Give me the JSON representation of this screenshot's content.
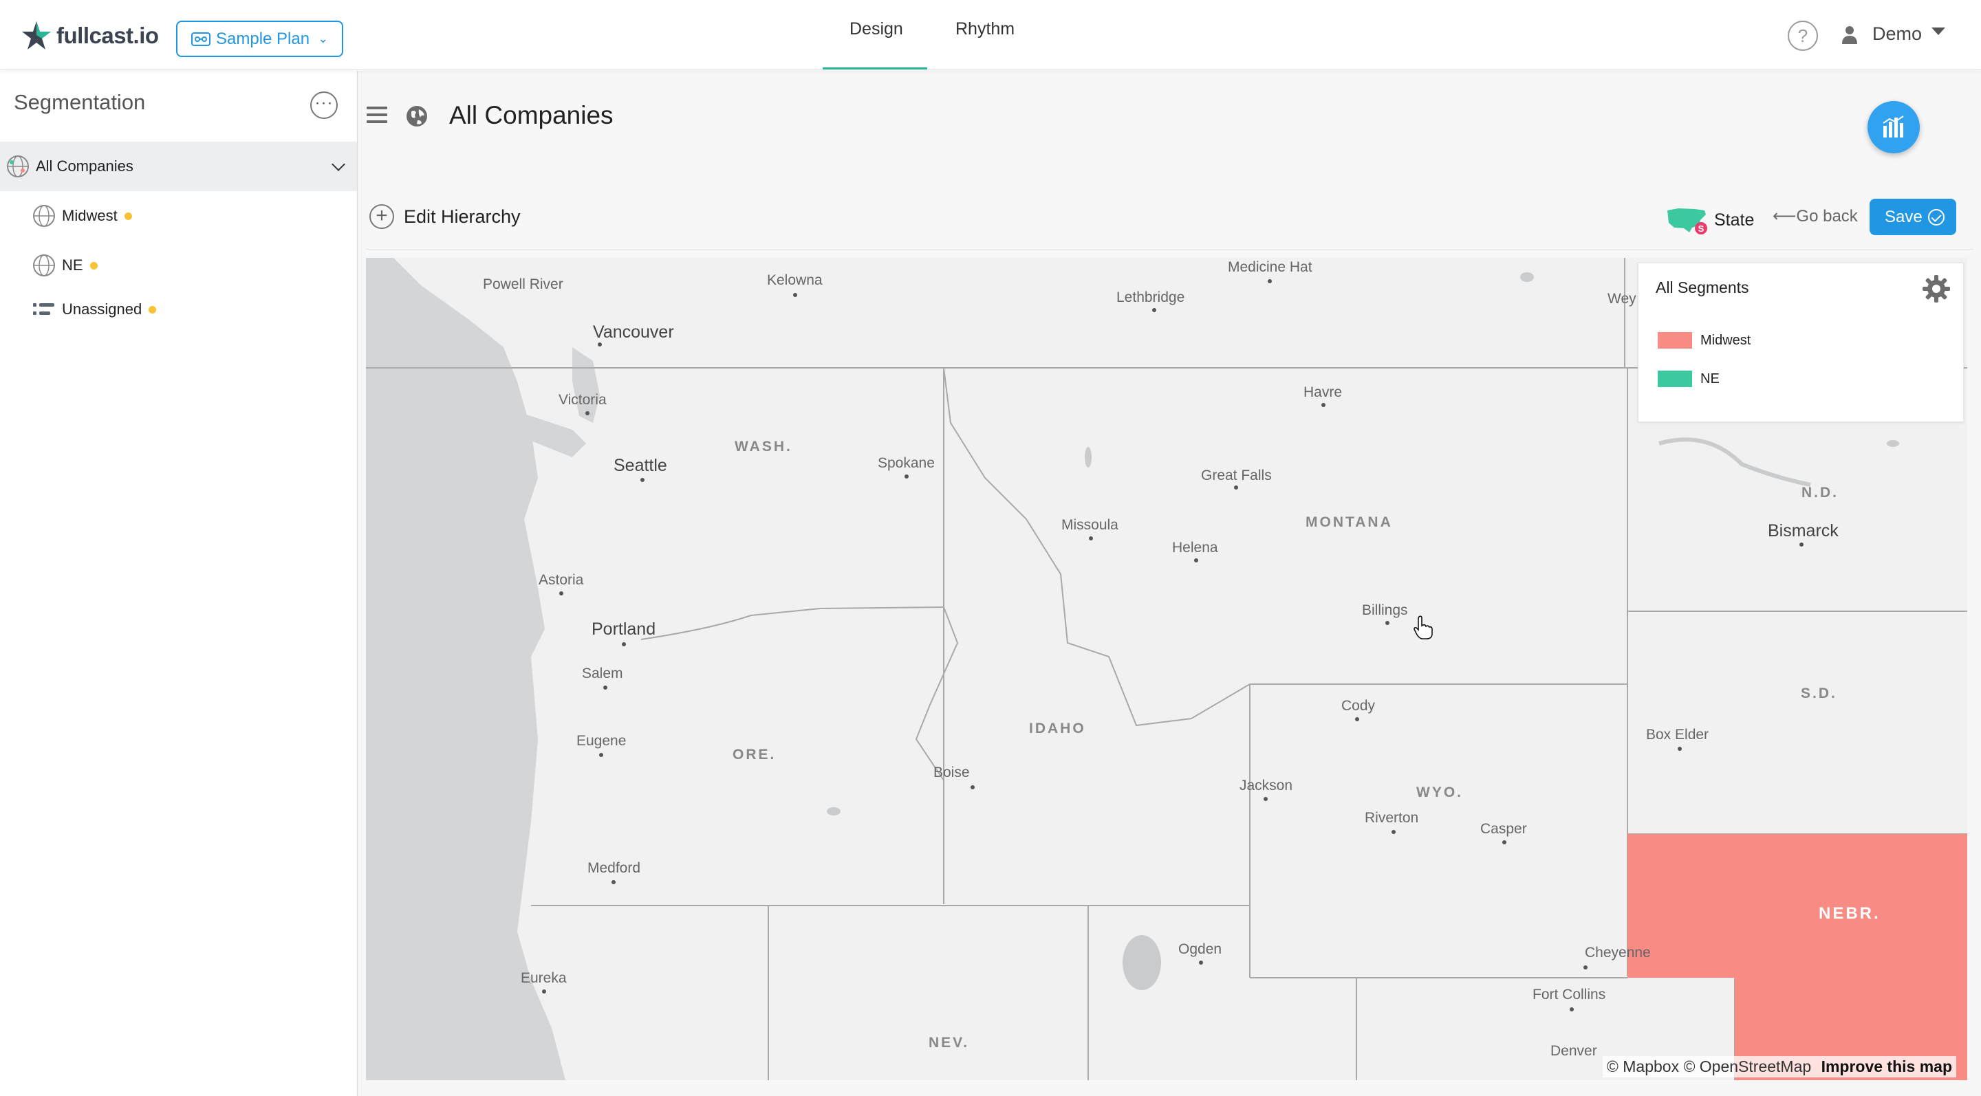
{
  "header": {
    "logo_text": "fullcast.io",
    "plan_button_label": "Sample Plan",
    "tabs": [
      {
        "label": "Design",
        "active": true
      },
      {
        "label": "Rhythm",
        "active": false
      }
    ],
    "help_label": "?",
    "user_name": "Demo"
  },
  "sidebar": {
    "title": "Segmentation",
    "more_label": "···",
    "items": [
      {
        "label": "All Companies",
        "active": true,
        "icon": "globe-icon"
      },
      {
        "label": "Midwest",
        "status_color": "#f7c233",
        "icon": "globe-icon"
      },
      {
        "label": "NE",
        "status_color": "#f7c233",
        "icon": "globe-icon"
      },
      {
        "label": "Unassigned",
        "status_color": "#f7c233",
        "icon": "list-icon"
      }
    ]
  },
  "main": {
    "title": "All Companies",
    "edit_hierarchy_label": "Edit Hierarchy",
    "level_toggle_label": "State",
    "go_back_label": "⟵Go back",
    "save_label": "Save"
  },
  "legend": {
    "title": "All Segments",
    "items": [
      {
        "label": "Midwest",
        "color": "#f98b85"
      },
      {
        "label": "NE",
        "color": "#3cc9a0"
      }
    ]
  },
  "map": {
    "cities": [
      "Medicine Hat",
      "Powell River",
      "Kelowna",
      "Lethbridge",
      "Wey",
      "Vancouver",
      "Victoria",
      "Havre",
      "Seattle",
      "Spokane",
      "Great Falls",
      "Missoula",
      "Helena",
      "Bismarck",
      "Astoria",
      "Billings",
      "Portland",
      "Salem",
      "Cody",
      "Eugene",
      "Box Elder",
      "Boise",
      "Jackson",
      "Riverton",
      "Casper",
      "Medford",
      "Ogden",
      "Cheyenne",
      "Eureka",
      "Fort Collins",
      "Denver"
    ],
    "states": [
      "WASH.",
      "MONTANA",
      "N.D.",
      "S.D.",
      "IDAHO",
      "ORE.",
      "WYO.",
      "NEV.",
      "NEBR."
    ],
    "attribution": "© Mapbox © OpenStreetMap",
    "improve_link": "Improve this map"
  },
  "colors": {
    "accent": "#2196e3",
    "tab_underline": "#2bb59a",
    "midwest": "#f98b85",
    "ne": "#3cc9a0"
  }
}
